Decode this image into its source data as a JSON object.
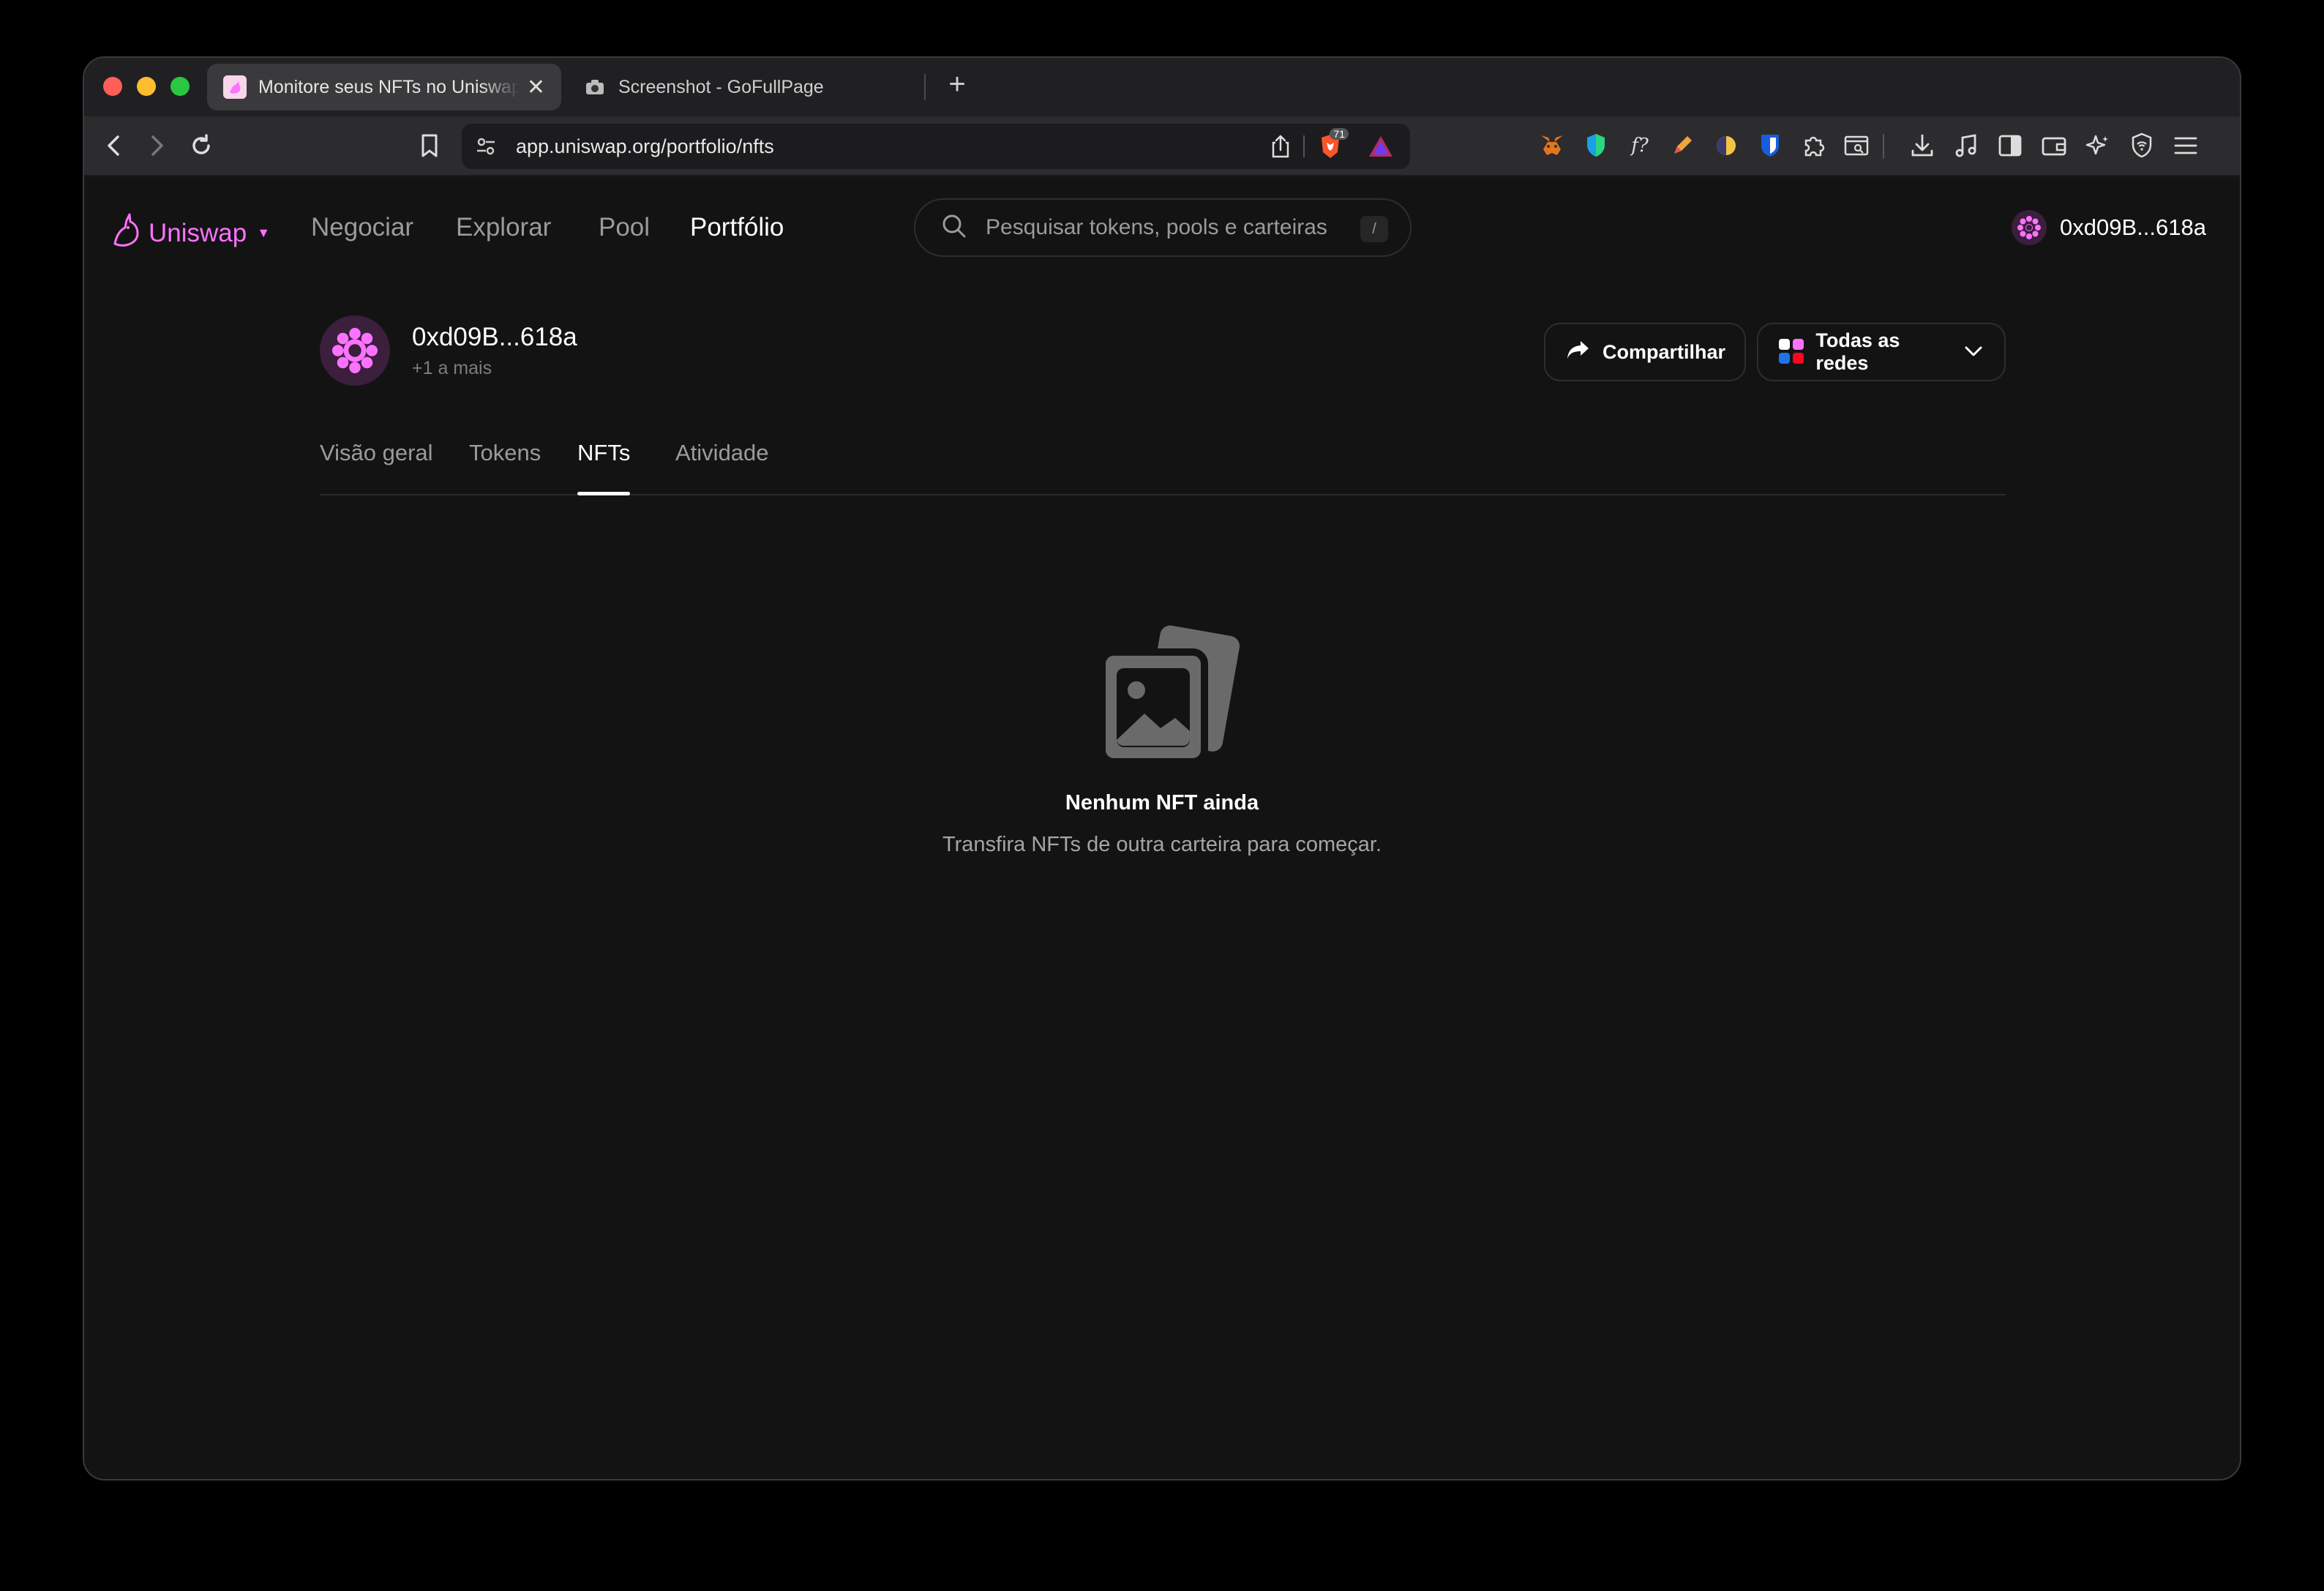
{
  "browser": {
    "tabs": [
      {
        "title": "Monitore seus NFTs no Uniswap",
        "active": true
      },
      {
        "title": "Screenshot - GoFullPage",
        "active": false
      }
    ],
    "close_symbol": "✕",
    "new_tab_symbol": "+",
    "url": "app.uniswap.org/portfolio/nfts",
    "brave_badge_count": "71",
    "extensions": [
      "metamask-icon",
      "shield-icon",
      "function-icon",
      "pen-icon",
      "moon-icon",
      "bitwarden-icon",
      "puzzle-icon",
      "reader-icon",
      "download-icon",
      "music-icon",
      "sidebar-icon",
      "wallet-icon",
      "sparkle-icon",
      "vpn-icon",
      "menu-icon"
    ]
  },
  "app": {
    "brand": "Uniswap",
    "nav": [
      "Negociar",
      "Explorar",
      "Pool",
      "Portfólio"
    ],
    "active_nav": "Portfólio",
    "search_placeholder": "Pesquisar tokens, pools e carteiras",
    "search_shortcut": "/",
    "account": "0xd09B...618a",
    "accent": "#fc72ff"
  },
  "profile": {
    "address": "0xd09B...618a",
    "more": "+1 a mais",
    "share_label": "Compartilhar",
    "networks_label": "Todas as redes"
  },
  "portfolio_tabs": [
    "Visão geral",
    "Tokens",
    "NFTs",
    "Atividade"
  ],
  "active_tab": "NFTs",
  "empty_state": {
    "title": "Nenhum NFT ainda",
    "subtitle": "Transfira NFTs de outra carteira para começar."
  },
  "help_label": "?"
}
